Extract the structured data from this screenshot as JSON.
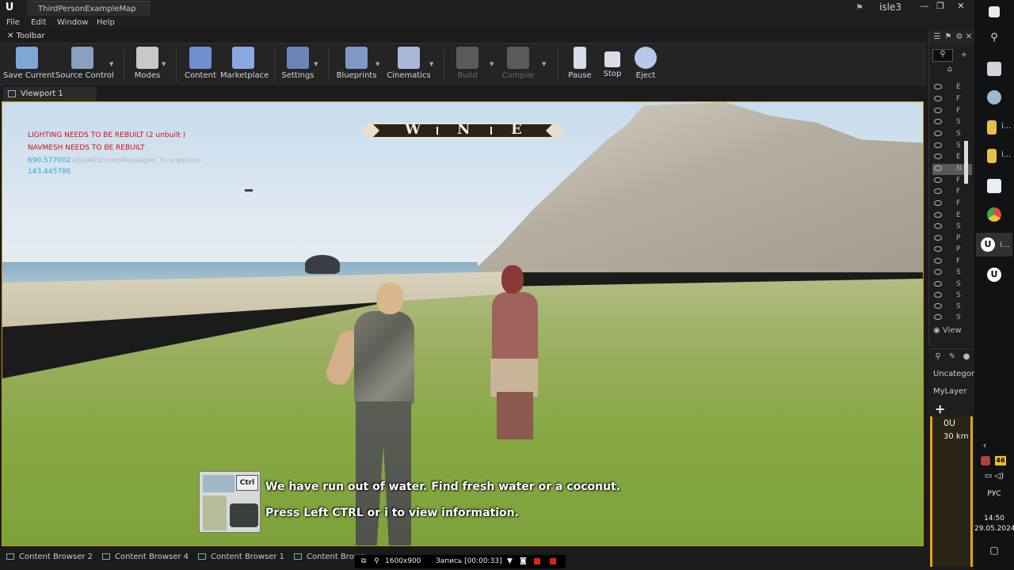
{
  "app": {
    "document_tab": "ThirdPersonExampleMap",
    "project_name": "isle3",
    "window_buttons": {
      "minimize": "—",
      "restore": "❐",
      "close": "✕"
    }
  },
  "menu": [
    "File",
    "Edit",
    "Window",
    "Help"
  ],
  "toolbar": {
    "tab_label": "Toolbar",
    "buttons": [
      {
        "label": "Save Current",
        "icon": "save-icon",
        "color": "#7fa6d6"
      },
      {
        "label": "Source Control",
        "icon": "source-control-icon",
        "color": "#8aa0c0"
      },
      {
        "label": "Modes",
        "icon": "modes-icon",
        "color": "#c8c8c8"
      },
      {
        "label": "Content",
        "icon": "content-icon",
        "color": "#6d8fd0"
      },
      {
        "label": "Marketplace",
        "icon": "marketplace-icon",
        "color": "#8aa8e0"
      },
      {
        "label": "Settings",
        "icon": "settings-icon",
        "color": "#6a86b8"
      },
      {
        "label": "Blueprints",
        "icon": "blueprints-icon",
        "color": "#7f98c8"
      },
      {
        "label": "Cinematics",
        "icon": "cinematics-icon",
        "color": "#a8b8d8"
      },
      {
        "label": "Build",
        "icon": "build-icon",
        "color": "#5a5a5a"
      },
      {
        "label": "Compile",
        "icon": "compile-icon",
        "color": "#5a5a5a"
      },
      {
        "label": "Pause",
        "icon": "pause-icon",
        "color": "#d8dde8"
      },
      {
        "label": "Stop",
        "icon": "stop-icon",
        "color": "#d8dde8"
      },
      {
        "label": "Eject",
        "icon": "eject-icon",
        "color": "#b8c8e8"
      }
    ]
  },
  "viewport": {
    "tab_label": "Viewport 1",
    "debug_messages": {
      "lighting": "LIGHTING NEEDS TO BE REBUILT (2 unbuilt )",
      "navmesh": "NAVMESH NEEDS TO BE REBUILT",
      "value1": "690.577002",
      "suppress": "ableAllScreenMessages' to suppress",
      "value2": "143.445786"
    },
    "compass": {
      "west": "W",
      "north": "N",
      "east": "E"
    },
    "message": {
      "key_label": "Ctrl",
      "line1": "We have run out of water. Find fresh water or a coconut.",
      "line2": "Press Left CTRL or i to view information."
    }
  },
  "bottom_tabs": [
    "Content Browser 2",
    "Content Browser 4",
    "Content Browser 1",
    "Content Brows"
  ],
  "recorder": {
    "resolution": "1600x900",
    "recording": "Запись [00:00:33]"
  },
  "outliner": {
    "rows": [
      "E",
      "F",
      "F",
      "S",
      "S",
      "S",
      "E",
      "N",
      "F",
      "F",
      "F",
      "E",
      "S",
      "P",
      "P",
      "F",
      "S",
      "S",
      "S",
      "S",
      "S"
    ],
    "view_label": "View"
  },
  "layers": {
    "items": [
      "Uncategori",
      "MyLayer"
    ],
    "add": "+"
  },
  "preview": {
    "line1": "0U",
    "line2": "30 km"
  },
  "taskbar": {
    "items_label": "i...",
    "lang": "РУС",
    "time": "14:50",
    "date": "29.05.2024",
    "badge": "46"
  }
}
